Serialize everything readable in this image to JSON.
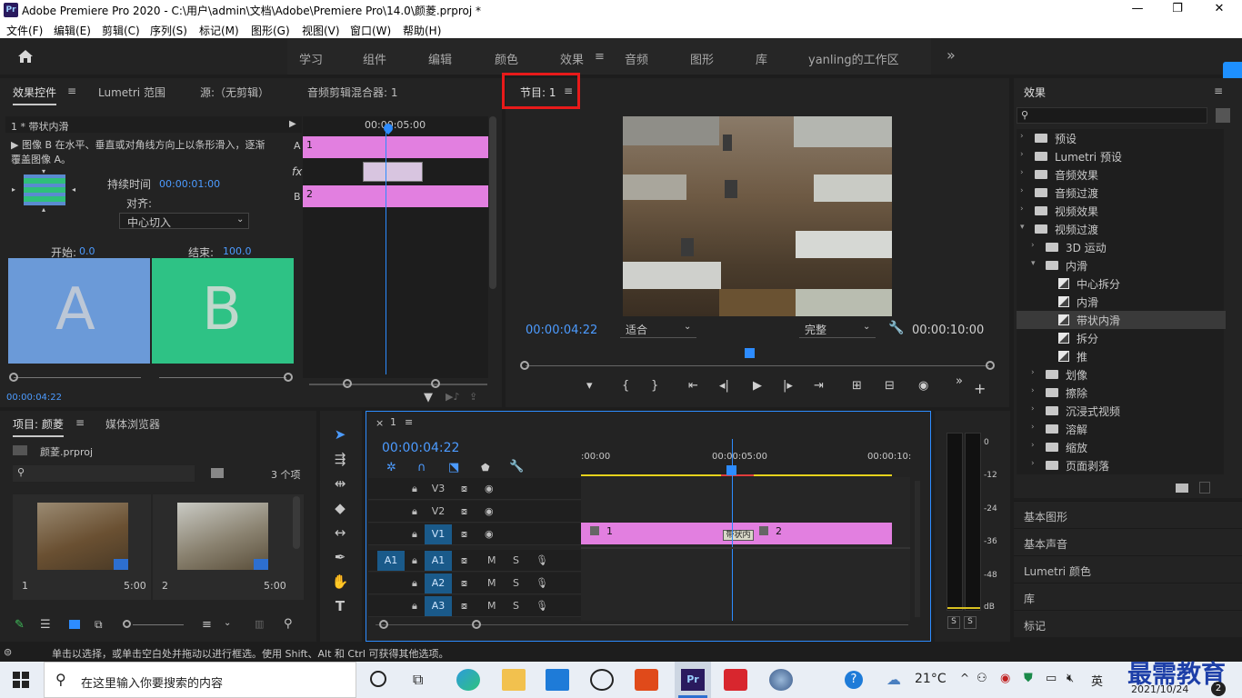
{
  "window": {
    "title": "Adobe Premiere Pro 2020 - C:\\用户\\admin\\文档\\Adobe\\Premiere Pro\\14.0\\颜菱.prproj *",
    "logo": "Pr",
    "minimize": "—",
    "restore": "❐",
    "close": "✕"
  },
  "menu": [
    "文件(F)",
    "编辑(E)",
    "剪辑(C)",
    "序列(S)",
    "标记(M)",
    "图形(G)",
    "视图(V)",
    "窗口(W)",
    "帮助(H)"
  ],
  "workspaces": {
    "items": [
      "学习",
      "组件",
      "编辑",
      "颜色",
      "效果",
      "音频",
      "图形",
      "库",
      "yanling的工作区"
    ],
    "active": "效果",
    "more": "»",
    "menu_icon": "≡"
  },
  "source_panel": {
    "tabs": [
      "效果控件",
      "Lumetri 范围",
      "源:（无剪辑）",
      "音频剪辑混合器: 1"
    ],
    "active_tab_menu": "≡",
    "clip_title": "1 * 带状内滑",
    "description": "▶ 图像 B 在水平、垂直或对角线方向上以条形滑入，逐渐覆盖图像 A。",
    "duration_label": "持续时间",
    "duration_value": "00:00:01:00",
    "align_label": "对齐:",
    "align_value": "中心切入",
    "start_label": "开始:",
    "start_value": "0.0",
    "end_label": "结束:",
    "end_value": "100.0",
    "preview_a": "A",
    "preview_b": "B",
    "mini_timecode": "00:00:05:00",
    "track_a": "A",
    "track_b": "B",
    "fx": "fx",
    "clip1": "1",
    "clip2": "2",
    "current_time": "00:00:04:22"
  },
  "program_monitor": {
    "title": "节目: 1",
    "menu": "≡",
    "timecode": "00:00:04:22",
    "fit": "适合",
    "quality": "完整",
    "duration": "00:00:10:00",
    "transport": [
      "▾",
      "{",
      "}",
      "⇤",
      "◂|",
      "▶",
      "|▸",
      "⇥",
      "⊞",
      "⊟",
      "◉",
      "»",
      "+"
    ]
  },
  "effects_panel": {
    "title": "效果",
    "menu": "≡",
    "tree": [
      {
        "label": "预设",
        "level": 0,
        "expanded": false,
        "type": "folder"
      },
      {
        "label": "Lumetri 预设",
        "level": 0,
        "expanded": false,
        "type": "folder"
      },
      {
        "label": "音频效果",
        "level": 0,
        "expanded": false,
        "type": "folder"
      },
      {
        "label": "音频过渡",
        "level": 0,
        "expanded": false,
        "type": "folder"
      },
      {
        "label": "视频效果",
        "level": 0,
        "expanded": false,
        "type": "folder"
      },
      {
        "label": "视频过渡",
        "level": 0,
        "expanded": true,
        "type": "folder"
      },
      {
        "label": "3D 运动",
        "level": 1,
        "expanded": false,
        "type": "folder"
      },
      {
        "label": "内滑",
        "level": 1,
        "expanded": true,
        "type": "folder"
      },
      {
        "label": "中心拆分",
        "level": 2,
        "type": "fx"
      },
      {
        "label": "内滑",
        "level": 2,
        "type": "fx"
      },
      {
        "label": "带状内滑",
        "level": 2,
        "type": "fx",
        "selected": true
      },
      {
        "label": "拆分",
        "level": 2,
        "type": "fx"
      },
      {
        "label": "推",
        "level": 2,
        "type": "fx"
      },
      {
        "label": "划像",
        "level": 1,
        "expanded": false,
        "type": "folder"
      },
      {
        "label": "擦除",
        "level": 1,
        "expanded": false,
        "type": "folder"
      },
      {
        "label": "沉浸式视频",
        "level": 1,
        "expanded": false,
        "type": "folder"
      },
      {
        "label": "溶解",
        "level": 1,
        "expanded": false,
        "type": "folder"
      },
      {
        "label": "缩放",
        "level": 1,
        "expanded": false,
        "type": "folder"
      },
      {
        "label": "页面剥落",
        "level": 1,
        "expanded": false,
        "type": "folder"
      }
    ],
    "sections": [
      "基本图形",
      "基本声音",
      "Lumetri 颜色",
      "库",
      "标记"
    ]
  },
  "project_panel": {
    "tabs": [
      "项目: 颜菱",
      "媒体浏览器"
    ],
    "menu": "≡",
    "file": "颜菱.prproj",
    "count": "3 个项",
    "items": [
      {
        "name": "1",
        "duration": "5:00"
      },
      {
        "name": "2",
        "duration": "5:00"
      }
    ]
  },
  "timeline": {
    "sequence": "1",
    "close": "×",
    "menu": "≡",
    "timecode": "00:00:04:22",
    "ruler": [
      ":00:00",
      "00:00:05:00",
      "00:00:10:"
    ],
    "video_tracks": [
      "V3",
      "V2",
      "V1"
    ],
    "audio_tracks": [
      "A1",
      "A2",
      "A3"
    ],
    "source_patch": "A1",
    "m": "M",
    "s": "S",
    "clip1": "1",
    "clip2": "2",
    "transition": "带状内"
  },
  "meter": {
    "scale": [
      "0",
      "-12",
      "-24",
      "-36",
      "-48",
      "dB"
    ],
    "solo": [
      "S",
      "S"
    ]
  },
  "status": {
    "text": "单击以选择，或单击空白处并拖动以进行框选。使用 Shift、Alt 和 Ctrl 可获得其他选项。"
  },
  "taskbar": {
    "search_placeholder": "在这里输入你要搜索的内容",
    "temp": "21°C",
    "lang": "英",
    "date": "2021/10/24",
    "notif": "2",
    "watermark": "最需教育"
  }
}
